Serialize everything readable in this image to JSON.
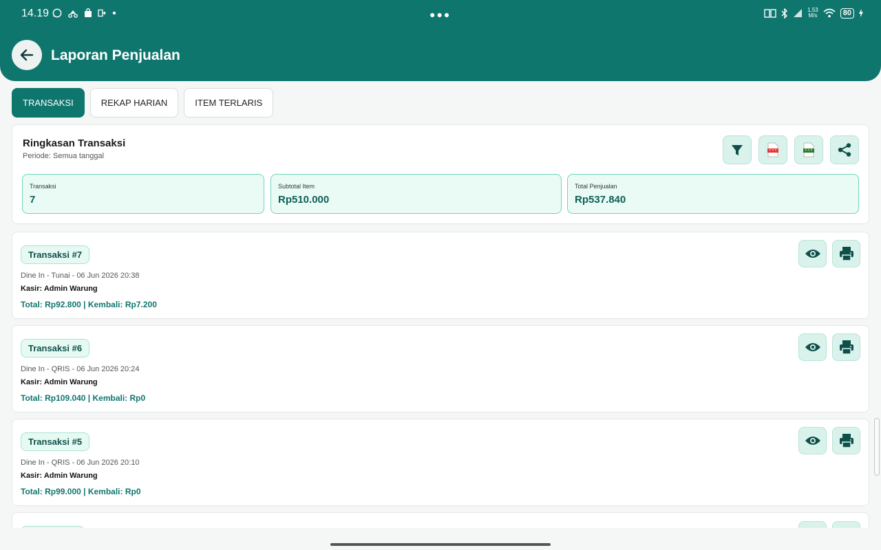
{
  "status_bar": {
    "time": "14.19",
    "speed": "1,53",
    "speed_unit": "M/s",
    "battery": "80"
  },
  "header": {
    "title": "Laporan Penjualan"
  },
  "tabs": [
    {
      "label": "TRANSAKSI",
      "active": true
    },
    {
      "label": "REKAP HARIAN",
      "active": false
    },
    {
      "label": "ITEM TERLARIS",
      "active": false
    }
  ],
  "summary": {
    "title": "Ringkasan Transaksi",
    "period": "Periode: Semua tanggal",
    "actions": [
      "filter-icon",
      "pdf-icon",
      "xls-icon",
      "share-icon"
    ],
    "metrics": [
      {
        "label": "Transaksi",
        "value": "7"
      },
      {
        "label": "Subtotal Item",
        "value": "Rp510.000"
      },
      {
        "label": "Total Penjualan",
        "value": "Rp537.840"
      }
    ]
  },
  "transactions": [
    {
      "title": "Transaksi #7",
      "meta": "Dine In - Tunai - 06 Jun 2026 20:38",
      "cashier": "Kasir: Admin Warung",
      "totals": "Total: Rp92.800 | Kembali: Rp7.200"
    },
    {
      "title": "Transaksi #6",
      "meta": "Dine In - QRIS - 06 Jun 2026 20:24",
      "cashier": "Kasir: Admin Warung",
      "totals": "Total: Rp109.040 | Kembali: Rp0"
    },
    {
      "title": "Transaksi #5",
      "meta": "Dine In - QRIS - 06 Jun 2026 20:10",
      "cashier": "Kasir: Admin Warung",
      "totals": "Total: Rp99.000 | Kembali: Rp0"
    }
  ],
  "colors": {
    "primary": "#0f766e",
    "accent_bg": "#d9f2ec",
    "metric_bg": "#e9fbf4"
  }
}
